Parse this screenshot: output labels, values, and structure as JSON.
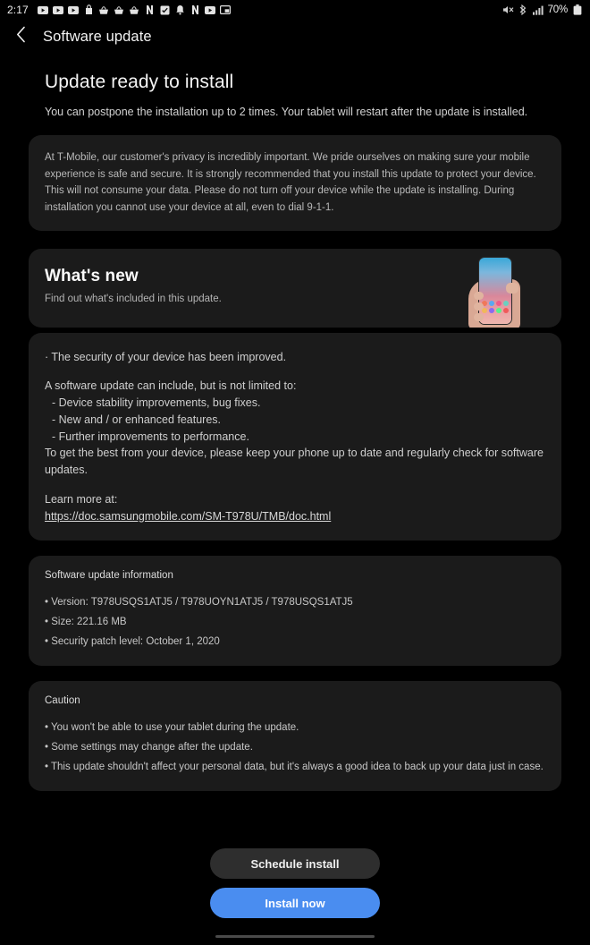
{
  "statusbar": {
    "clock": "2:17",
    "left_icons": [
      "youtube-play-icon",
      "youtube-play-icon",
      "youtube-play-icon",
      "shopping-bag-icon",
      "shopping-basket-icon",
      "shopping-basket-icon",
      "shopping-basket-icon",
      "netflix-icon",
      "checkbox-icon",
      "bell-icon",
      "netflix-icon",
      "video-play-icon",
      "picture-in-picture-icon"
    ],
    "right_icons": [
      "mute-icon",
      "bluetooth-icon",
      "signal-bars-icon"
    ],
    "battery_percent": "70%",
    "battery_icon": "battery-icon"
  },
  "appbar": {
    "back_icon": "back-chevron-icon",
    "title": "Software update"
  },
  "page": {
    "title": "Update ready to install",
    "subtitle": "You can postpone the installation up to 2 times. Your tablet will restart after the update is installed."
  },
  "privacy_card": {
    "text": "At T-Mobile, our customer's privacy is incredibly important. We pride ourselves on making sure your mobile experience is safe and secure. It is strongly recommended that you install this update to protect your device. This will not consume your data. Please do not turn off your device while the update is installing. During installation you cannot use your device at all, even to dial 9-1-1."
  },
  "whats_new": {
    "heading": "What's new",
    "subheading": "Find out what's included in this update.",
    "illustration": "hand-holding-phone-image",
    "phone_icon_colors": [
      "#f0785a",
      "#5aa8f0",
      "#f05a8a",
      "#6ad0c0",
      "#f0b85a",
      "#8a6af0",
      "#5af08a",
      "#f05a5a",
      "#5ad0f0",
      "#f0a05a",
      "#a05af0",
      "#5af0d0"
    ]
  },
  "release_notes": {
    "line1": "· The security of your device has been improved.",
    "line2": "A software update can include, but is not limited to:",
    "bullets": [
      "- Device stability improvements, bug fixes.",
      "- New and / or enhanced features.",
      "- Further improvements to performance."
    ],
    "line3": "To get the best from your device, please keep your phone up to date and regularly check for software updates.",
    "learn_more_label": "Learn more at:",
    "learn_more_url": "https://doc.samsungmobile.com/SM-T978U/TMB/doc.html"
  },
  "update_info": {
    "heading": "Software update information",
    "items": [
      "• Version: T978USQS1ATJ5 / T978UOYN1ATJ5 / T978USQS1ATJ5",
      "• Size: 221.16 MB",
      "• Security patch level: October 1, 2020"
    ]
  },
  "caution": {
    "heading": "Caution",
    "items": [
      "• You won't be able to use your tablet during the update.",
      "• Some settings may change after the update.",
      "• This update shouldn't affect your personal data, but it's always a good idea to back up your data just in case."
    ]
  },
  "buttons": {
    "schedule_label": "Schedule install",
    "install_label": "Install now",
    "primary_color": "#4a8df0",
    "secondary_color": "#2e2e2e"
  }
}
